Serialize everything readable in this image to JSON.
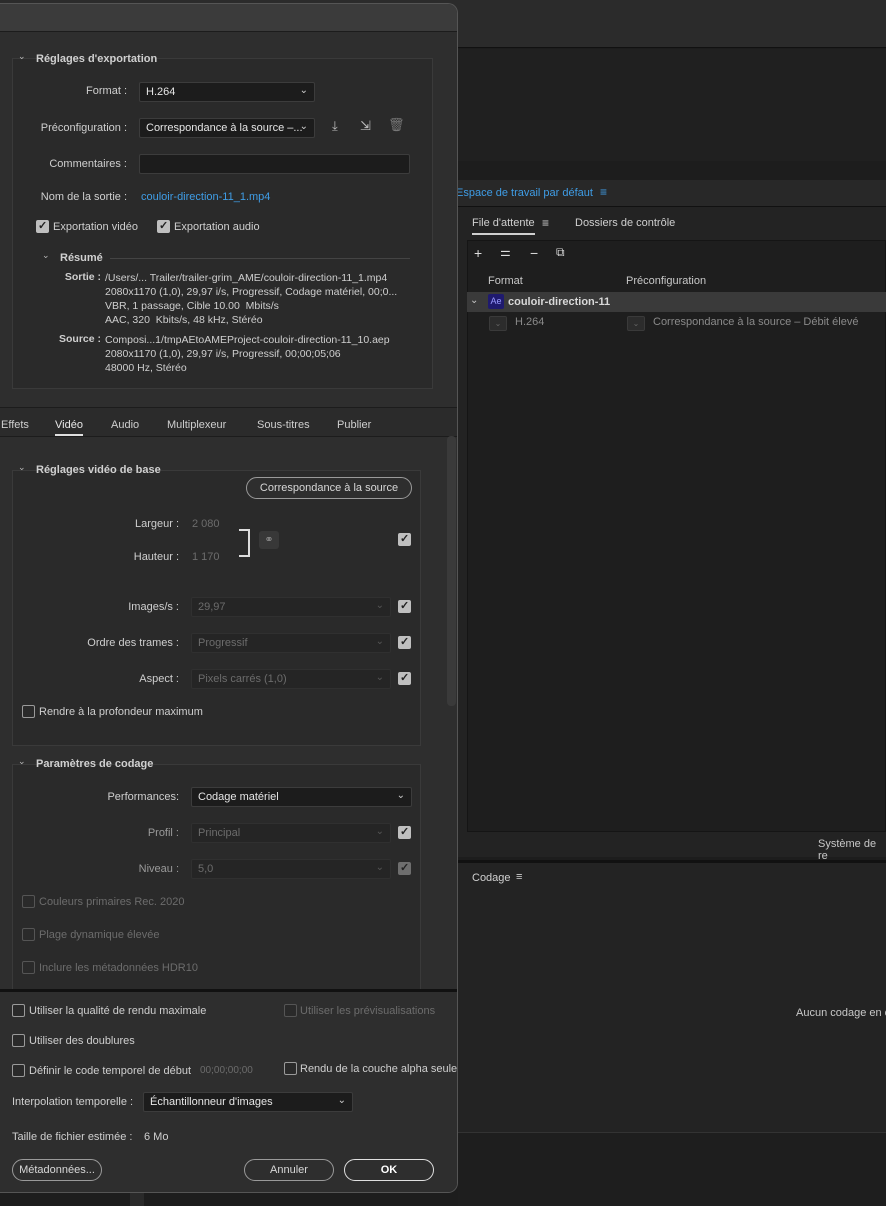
{
  "export": {
    "section_title": "Réglages d'exportation",
    "format_label": "Format :",
    "format_value": "H.264",
    "preset_label": "Préconfiguration :",
    "preset_value": "Correspondance à la source –...",
    "comments_label": "Commentaires :",
    "comments_value": "",
    "output_name_label": "Nom de la sortie :",
    "output_name_value": "couloir-direction-11_1.mp4",
    "export_video_label": "Exportation vidéo",
    "export_video_checked": true,
    "export_audio_label": "Exportation audio",
    "export_audio_checked": true,
    "summary_title": "Résumé",
    "output_label": "Sortie :",
    "output_lines": [
      "/Users/... Trailer/trailer-grim_AME/couloir-direction-11_1.mp4",
      "2080x1170 (1,0), 29,97 i/s, Progressif, Codage matériel, 00;0...",
      "VBR, 1 passage, Cible 10.00  Mbits/s",
      "AAC, 320  Kbits/s, 48 kHz, Stéréo"
    ],
    "source_label": "Source :",
    "source_lines": [
      "Composi...1/tmpAEtoAMEProject-couloir-direction-11_10.aep",
      "2080x1170 (1,0), 29,97 i/s, Progressif, 00;00;05;06",
      "48000 Hz, Stéréo"
    ]
  },
  "tabs": [
    "Effets",
    "Vidéo",
    "Audio",
    "Multiplexeur",
    "Sous-titres",
    "Publier"
  ],
  "active_tab": "Vidéo",
  "video_basic": {
    "title": "Réglages vidéo de base",
    "match_source_button": "Correspondance à la source",
    "width_label": "Largeur :",
    "width_value": "2 080",
    "height_label": "Hauteur :",
    "height_value": "1 170",
    "fps_label": "Images/s :",
    "fps_value": "29,97",
    "field_order_label": "Ordre des trames :",
    "field_order_value": "Progressif",
    "aspect_label": "Aspect :",
    "aspect_value": "Pixels carrés (1,0)",
    "max_depth_label": "Rendre à la profondeur maximum"
  },
  "encoding": {
    "title": "Paramètres de codage",
    "performance_label": "Performances:",
    "performance_value": "Codage matériel",
    "profile_label": "Profil :",
    "profile_value": "Principal",
    "level_label": "Niveau :",
    "level_value": "5,0",
    "rec2020_label": "Couleurs primaires Rec. 2020",
    "hdr_label": "Plage dynamique élevée",
    "hdr10_label": "Inclure les métadonnées HDR10"
  },
  "footer": {
    "max_quality_label": "Utiliser la qualité de rendu maximale",
    "use_previews_label": "Utiliser les prévisualisations",
    "use_proxies_label": "Utiliser des doublures",
    "start_timecode_label": "Définir le code temporel de début",
    "start_timecode_value": "00;00;00;00",
    "alpha_only_label": "Rendu de la couche alpha seule",
    "interpolation_label": "Interpolation temporelle :",
    "interpolation_value": "Échantillonneur d'images",
    "filesize_label": "Taille de fichier estimée :",
    "filesize_value": "6 Mo",
    "metadata_button": "Métadonnées...",
    "cancel_button": "Annuler",
    "ok_button": "OK"
  },
  "queue": {
    "workspace_tab": "Espace de travail par défaut",
    "tab_queue": "File d'attente",
    "tab_watch": "Dossiers de contrôle",
    "col_format": "Format",
    "col_preset": "Préconfiguration",
    "item_badge": "Ae",
    "item_name": "couloir-direction-11",
    "item_format": "H.264",
    "item_preset": "Correspondance à la source – Débit élevé",
    "renderer_text": "Système de re",
    "encoding_title": "Codage",
    "no_encoding_text": "Aucun codage en c"
  },
  "colors": {
    "accent": "#3f9de6",
    "panel": "#2e2e2e",
    "badge": "#1f1a6e"
  }
}
